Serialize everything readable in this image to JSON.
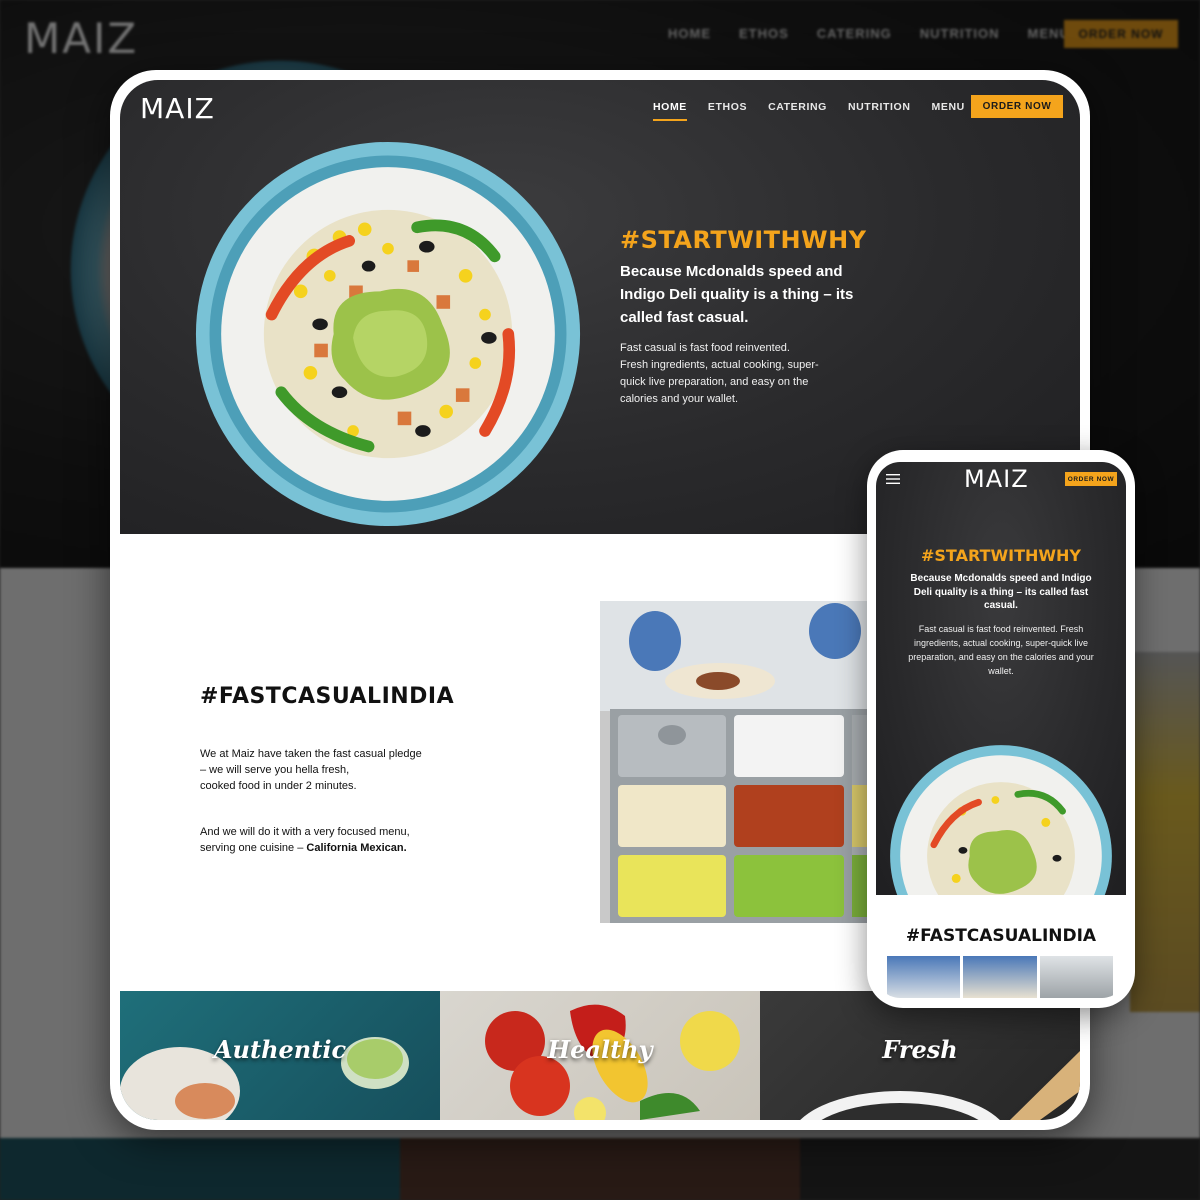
{
  "background": {
    "logo": "MAIZ",
    "nav": [
      "HOME",
      "ETHOS",
      "CATERING",
      "NUTRITION",
      "MENU"
    ],
    "order_label": "ORDER NOW"
  },
  "desktop": {
    "logo": "MAIZ",
    "nav": [
      {
        "label": "HOME",
        "active": true
      },
      {
        "label": "ETHOS",
        "active": false
      },
      {
        "label": "CATERING",
        "active": false
      },
      {
        "label": "NUTRITION",
        "active": false
      },
      {
        "label": "MENU",
        "active": false
      }
    ],
    "order_label": "ORDER NOW",
    "hero": {
      "title": "#STARTWITHWHY",
      "subtitle": "Because Mcdonalds speed and Indigo Deli quality is a thing – its called fast casual.",
      "body": "Fast casual is fast food reinvented. Fresh ingredients, actual cooking, super-quick live preparation, and easy on the calories and your wallet."
    },
    "fast_casual": {
      "title": "#FASTCASUALINDIA",
      "para1_lines": [
        "We at Maiz have taken the fast casual pledge",
        "– we will serve you hella fresh,",
        "cooked food in under 2 minutes."
      ],
      "para2_lines": [
        "And we will do it with a very focused menu,",
        "serving one cuisine – "
      ],
      "para2_bold": "California Mexican."
    },
    "tiles": [
      "Authentic",
      "Healthy",
      "Fresh"
    ]
  },
  "mobile": {
    "logo": "MAIZ",
    "order_label": "ORDER NOW",
    "hero": {
      "title": "#STARTWITHWHY",
      "subtitle": "Because Mcdonalds speed and Indigo Deli quality is a thing – its called fast casual.",
      "body": "Fast casual is fast food reinvented. Fresh ingredients, actual cooking, super-quick live preparation, and easy on the calories and your wallet."
    },
    "fast_casual_title": "#FASTCASUALINDIA"
  },
  "colors": {
    "accent": "#f4a41c",
    "hero_bg": "#2a2a2c",
    "plate_rim": "#6fb9cf"
  }
}
